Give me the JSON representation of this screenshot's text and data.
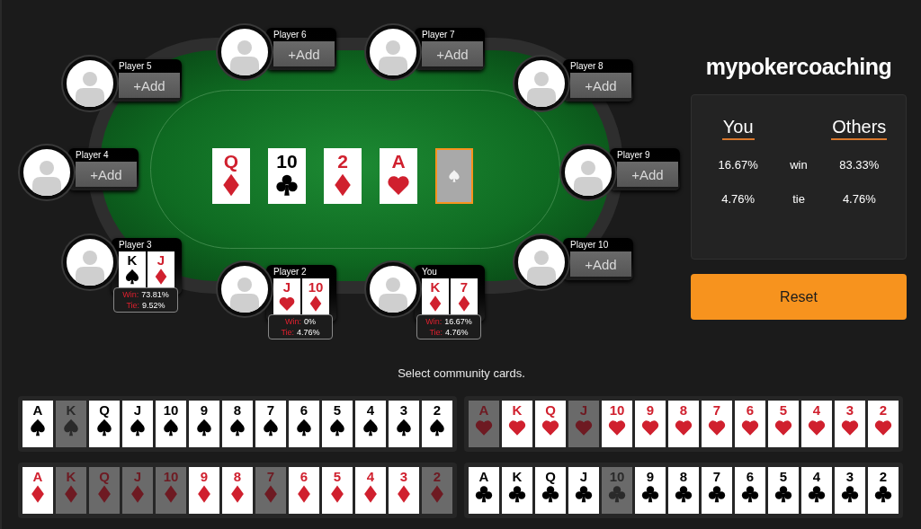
{
  "seats": [
    {
      "name": "Player 6",
      "kind": "empty",
      "add_label": "+Add"
    },
    {
      "name": "Player 7",
      "kind": "empty",
      "add_label": "+Add"
    },
    {
      "name": "Player 5",
      "kind": "empty",
      "add_label": "+Add"
    },
    {
      "name": "Player 8",
      "kind": "empty",
      "add_label": "+Add"
    },
    {
      "name": "Player 4",
      "kind": "empty",
      "add_label": "+Add"
    },
    {
      "name": "Player 9",
      "kind": "empty",
      "add_label": "+Add"
    },
    {
      "name": "Player 3",
      "kind": "hand",
      "cards": [
        {
          "rank": "K",
          "kind": "spades"
        },
        {
          "rank": "J",
          "kind": "diamonds"
        }
      ],
      "stats": [
        {
          "label": "Win:",
          "value": "73.81%"
        },
        {
          "label": "Tie:",
          "value": "9.52%"
        }
      ]
    },
    {
      "name": "Player 10",
      "kind": "empty",
      "add_label": "+Add"
    },
    {
      "name": "Player 2",
      "kind": "hand",
      "cards": [
        {
          "rank": "J",
          "kind": "hearts"
        },
        {
          "rank": "10",
          "kind": "diamonds"
        }
      ],
      "stats": [
        {
          "label": "Win:",
          "value": "0%"
        },
        {
          "label": "Tie:",
          "value": "4.76%"
        }
      ]
    },
    {
      "name": "You",
      "kind": "hand",
      "cards": [
        {
          "rank": "K",
          "kind": "diamonds"
        },
        {
          "rank": "7",
          "kind": "diamonds"
        }
      ],
      "stats": [
        {
          "label": "Win:",
          "value": "16.67%"
        },
        {
          "label": "Tie:",
          "value": "4.76%"
        }
      ]
    }
  ],
  "community": [
    {
      "kind": "diamonds",
      "rank": "Q",
      "selected": false
    },
    {
      "kind": "clubs",
      "rank": "10",
      "selected": false
    },
    {
      "kind": "diamonds",
      "rank": "2",
      "selected": false
    },
    {
      "kind": "hearts",
      "rank": "A",
      "selected": false
    },
    {
      "kind": "empty",
      "selected": true
    }
  ],
  "logo": "mypokercoaching",
  "equity": {
    "headers": [
      "You",
      "Others"
    ],
    "rows": [
      {
        "you": "16.67%",
        "label": "win",
        "others": "83.33%"
      },
      {
        "you": "4.76%",
        "label": "tie",
        "others": "4.76%"
      }
    ]
  },
  "reset_button": "Reset",
  "prompt": "Select community cards.",
  "deck": [
    {
      "kind": "spades",
      "cards": [
        {
          "rank": "A",
          "used": false
        },
        {
          "rank": "K",
          "used": true
        },
        {
          "rank": "Q",
          "used": false
        },
        {
          "rank": "J",
          "used": false
        },
        {
          "rank": "10",
          "used": false
        },
        {
          "rank": "9",
          "used": false
        },
        {
          "rank": "8",
          "used": false
        },
        {
          "rank": "7",
          "used": false
        },
        {
          "rank": "6",
          "used": false
        },
        {
          "rank": "5",
          "used": false
        },
        {
          "rank": "4",
          "used": false
        },
        {
          "rank": "3",
          "used": false
        },
        {
          "rank": "2",
          "used": false
        }
      ]
    },
    {
      "kind": "hearts",
      "cards": [
        {
          "rank": "A",
          "used": true
        },
        {
          "rank": "K",
          "used": false
        },
        {
          "rank": "Q",
          "used": false
        },
        {
          "rank": "J",
          "used": true
        },
        {
          "rank": "10",
          "used": false
        },
        {
          "rank": "9",
          "used": false
        },
        {
          "rank": "8",
          "used": false
        },
        {
          "rank": "7",
          "used": false
        },
        {
          "rank": "6",
          "used": false
        },
        {
          "rank": "5",
          "used": false
        },
        {
          "rank": "4",
          "used": false
        },
        {
          "rank": "3",
          "used": false
        },
        {
          "rank": "2",
          "used": false
        }
      ]
    },
    {
      "kind": "diamonds",
      "cards": [
        {
          "rank": "A",
          "used": false
        },
        {
          "rank": "K",
          "used": true
        },
        {
          "rank": "Q",
          "used": true
        },
        {
          "rank": "J",
          "used": true
        },
        {
          "rank": "10",
          "used": true
        },
        {
          "rank": "9",
          "used": false
        },
        {
          "rank": "8",
          "used": false
        },
        {
          "rank": "7",
          "used": true
        },
        {
          "rank": "6",
          "used": false
        },
        {
          "rank": "5",
          "used": false
        },
        {
          "rank": "4",
          "used": false
        },
        {
          "rank": "3",
          "used": false
        },
        {
          "rank": "2",
          "used": true
        }
      ]
    },
    {
      "kind": "clubs",
      "cards": [
        {
          "rank": "A",
          "used": false
        },
        {
          "rank": "K",
          "used": false
        },
        {
          "rank": "Q",
          "used": false
        },
        {
          "rank": "J",
          "used": false
        },
        {
          "rank": "10",
          "used": true
        },
        {
          "rank": "9",
          "used": false
        },
        {
          "rank": "8",
          "used": false
        },
        {
          "rank": "7",
          "used": false
        },
        {
          "rank": "6",
          "used": false
        },
        {
          "rank": "5",
          "used": false
        },
        {
          "rank": "4",
          "used": false
        },
        {
          "rank": "3",
          "used": false
        },
        {
          "rank": "2",
          "used": false
        }
      ]
    }
  ]
}
